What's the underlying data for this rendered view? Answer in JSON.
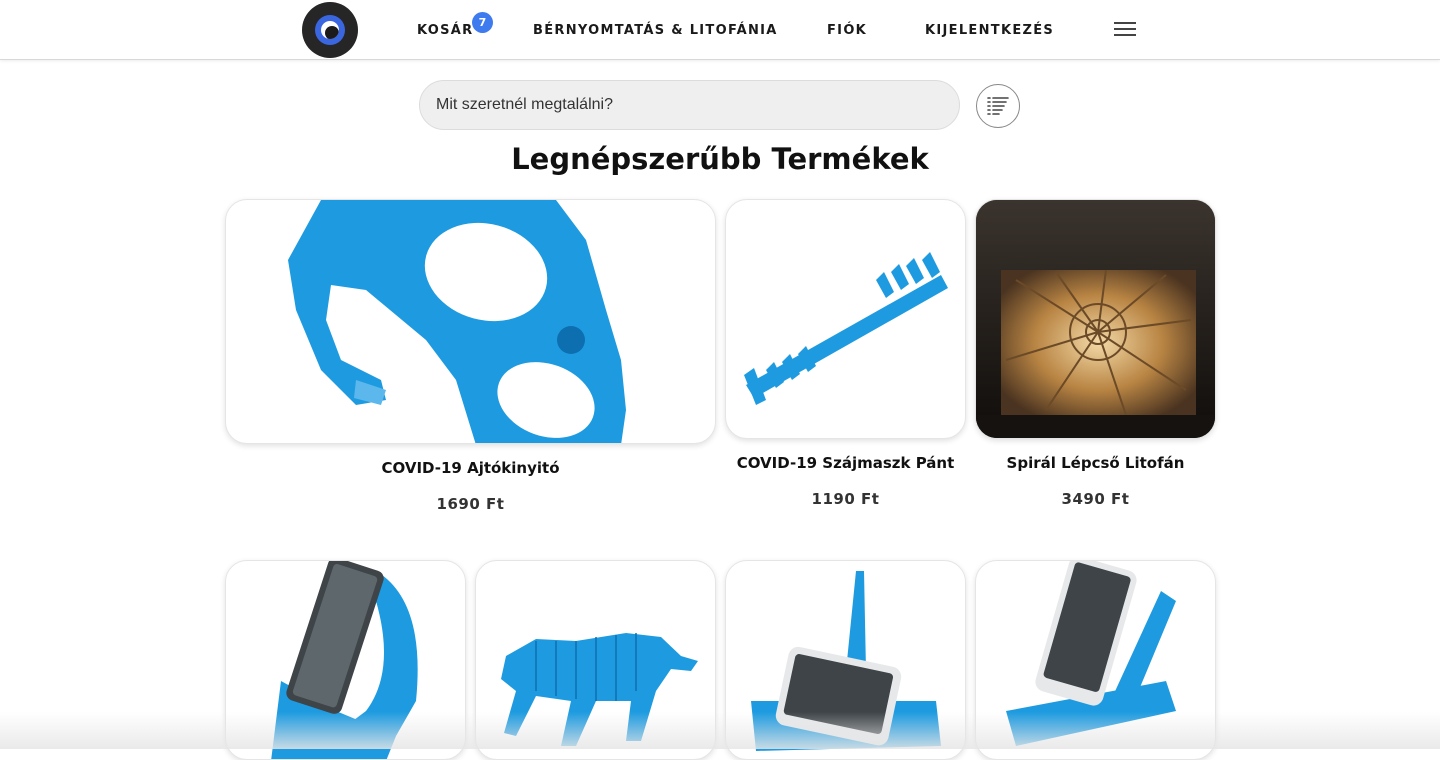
{
  "header": {
    "logo_icon": "eye-logo-icon",
    "nav": {
      "cart": "KOSÁR",
      "cart_count": "7",
      "print": "BÉRNYOMTATÁS & LITOFÁNIA",
      "account": "FIÓK",
      "logout": "KIJELENTKEZÉS"
    },
    "menu_icon": "hamburger-icon"
  },
  "search": {
    "placeholder": "Mit szeretnél megtalálni?",
    "filter_icon": "filter-list-icon"
  },
  "section_title": "Legnépszerűbb Termékek",
  "products": [
    {
      "name": "COVID-19 Ajtókinyitó",
      "price": "1690 Ft",
      "image": "blue-door-opener"
    },
    {
      "name": "COVID-19 Szájmaszk Pánt",
      "price": "1190 Ft",
      "image": "blue-mask-strap"
    },
    {
      "name": "Spirál Lépcső Litofán",
      "price": "3490 Ft",
      "image": "spiral-staircase-lithophane"
    },
    {
      "image": "blue-phone-stand-curved"
    },
    {
      "image": "blue-flexi-unicorn"
    },
    {
      "image": "blue-phone-stand-stylus"
    },
    {
      "image": "blue-phone-stand-a-frame"
    }
  ],
  "colors": {
    "accent_blue": "#3d7bef",
    "product_blue": "#1e9be0"
  }
}
